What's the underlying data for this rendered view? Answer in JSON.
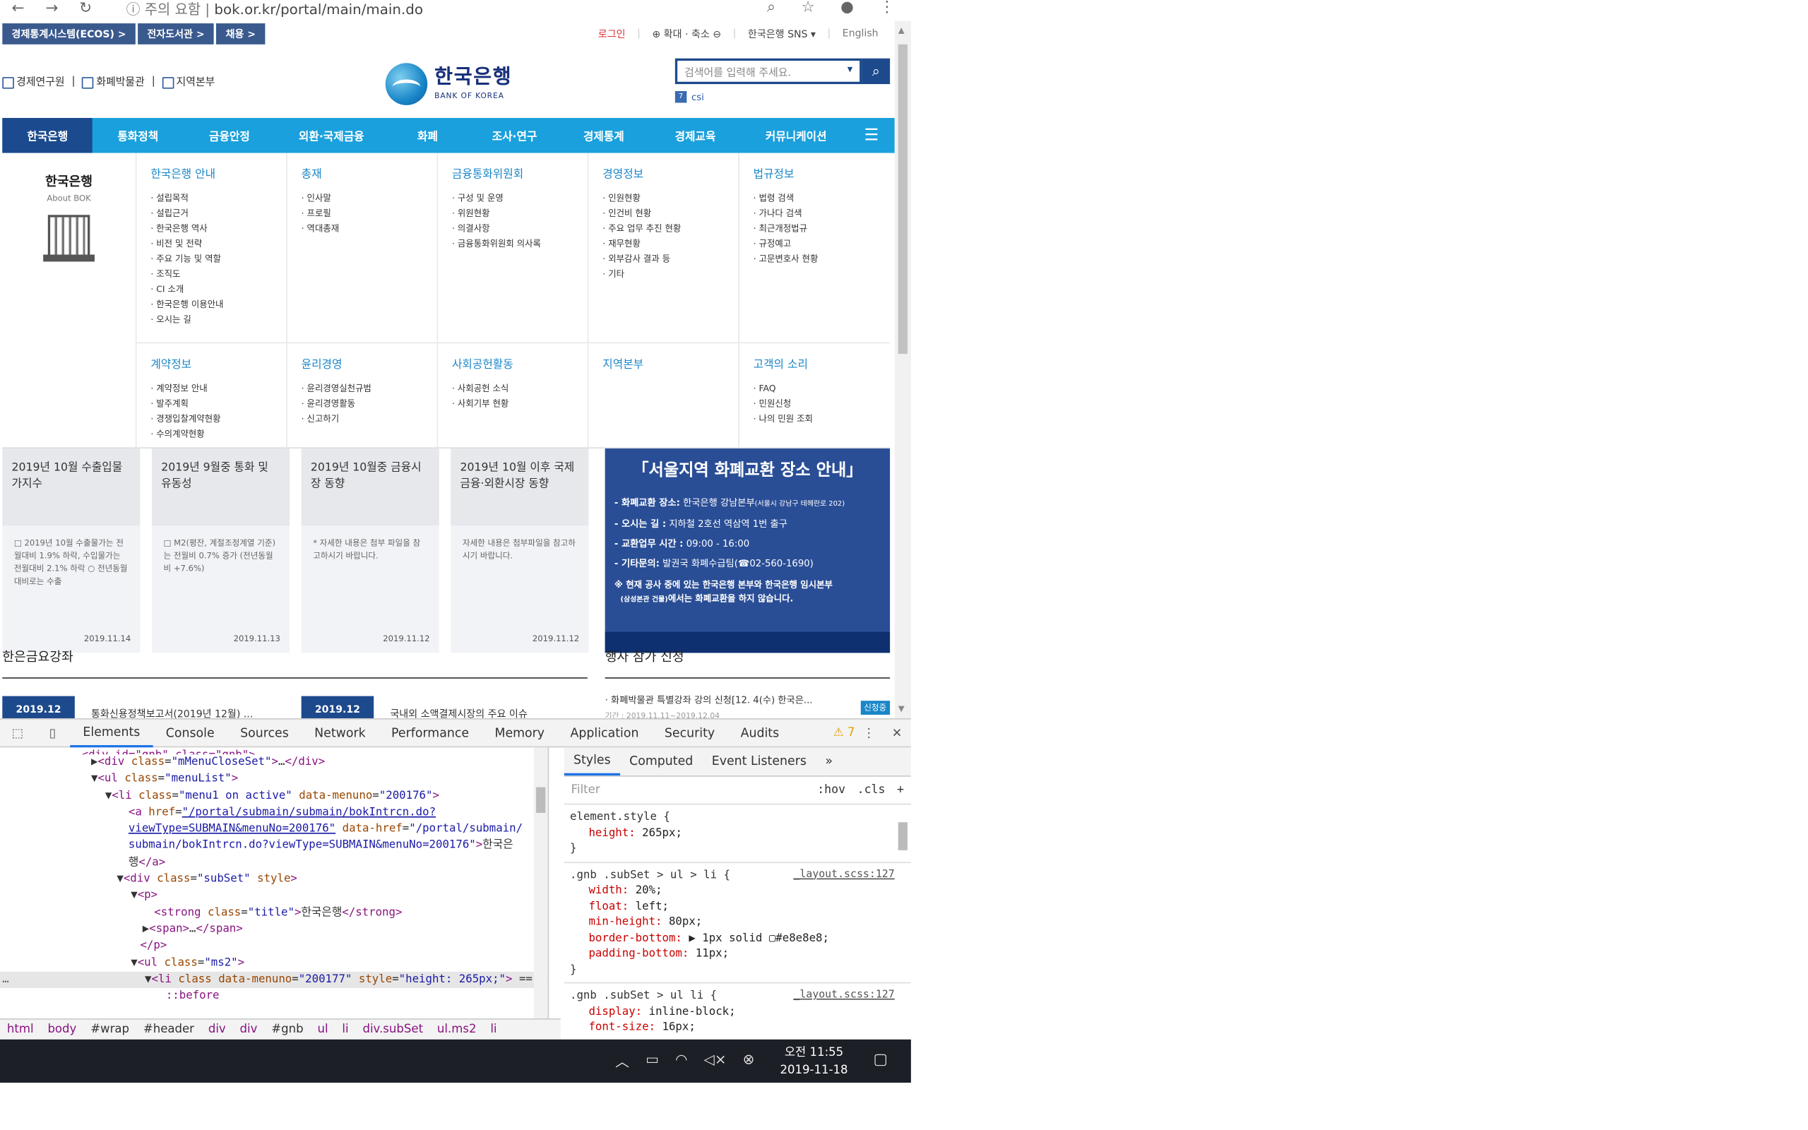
{
  "browser": {
    "url_prefix": "주의 요함",
    "url": "bok.or.kr/portal/main/main.do"
  },
  "utility": {
    "left_links": [
      "경제통계시스템(ECOS) >",
      "전자도서관 >",
      "채용 >"
    ],
    "login": "로그인",
    "zoom": "확대 · 축소",
    "sns": "한국은행 SNS",
    "english": "English"
  },
  "header": {
    "links": [
      "경제연구원",
      "화폐박물관",
      "지역본부"
    ],
    "logo_kr": "한국은행",
    "logo_en": "BANK OF KOREA",
    "search_placeholder": "검색어를 입력해 주세요.",
    "csi": "csi"
  },
  "gnb": {
    "items": [
      "한국은행",
      "통화정책",
      "금융안정",
      "외환·국제금융",
      "화폐",
      "조사·연구",
      "경제통계",
      "경제교육",
      "커뮤니케이션"
    ]
  },
  "mega": {
    "about_title": "한국은행",
    "about_sub": "About BOK",
    "row1": [
      {
        "title": "한국은행 안내",
        "items": [
          "설립목적",
          "설립근거",
          "한국은행 역사",
          "비전 및 전략",
          "주요 기능 및 역할",
          "조직도",
          "CI 소개",
          "한국은행 이용안내",
          "오시는 길"
        ]
      },
      {
        "title": "총재",
        "items": [
          "인사말",
          "프로필",
          "역대총재"
        ]
      },
      {
        "title": "금융통화위원회",
        "items": [
          "구성 및 운영",
          "위원현황",
          "의결사항",
          "금융통화위원회 의사록"
        ]
      },
      {
        "title": "경영정보",
        "items": [
          "인원현황",
          "인건비 현황",
          "주요 업무 추진 현황",
          "재무현황",
          "외부감사 결과 등",
          "기타"
        ]
      },
      {
        "title": "법규정보",
        "items": [
          "법령 검색",
          "가나다 검색",
          "최근개정법규",
          "규정예고",
          "고문변호사 현황"
        ]
      }
    ],
    "row2": [
      {
        "title": "계약정보",
        "items": [
          "계약정보 안내",
          "발주계획",
          "경쟁입찰계약현황",
          "수의계약현황"
        ]
      },
      {
        "title": "윤리경영",
        "items": [
          "윤리경영실천규범",
          "윤리경영활동",
          "신고하기"
        ]
      },
      {
        "title": "사회공헌활동",
        "items": [
          "사회공헌 소식",
          "사회기부 현황"
        ]
      },
      {
        "title": "지역본부",
        "items": []
      },
      {
        "title": "고객의 소리",
        "items": [
          "FAQ",
          "민원신청",
          "나의 민원 조회"
        ]
      }
    ]
  },
  "cards": [
    {
      "title": "2019년 10월 수출입물가지수",
      "body": "□ 2019년 10월 수출물가는 전월대비 1.9% 하락, 수입물가는 전월대비 2.1% 하락 ○ 전년동월대비로는 수출",
      "date": "2019.11.14"
    },
    {
      "title": "2019년 9월중 통화 및 유동성",
      "body": "□ M2(평잔, 계절조정계열 기준)는 전월비 0.7% 증가 (전년동월비 +7.6%)",
      "date": "2019.11.13"
    },
    {
      "title": "2019년 10월중 금융시장 동향",
      "body": "* 자세한 내용은 첨부 파일을 참고하시기 바랍니다.",
      "date": "2019.11.12"
    },
    {
      "title": "2019년 10월 이후 국제금융·외환시장 동향",
      "body": "자세한 내용은 첨부파일을 참고하시기 바랍니다.",
      "date": "2019.11.12"
    }
  ],
  "banner": {
    "title": "「서울지역 화폐교환 장소 안내」",
    "l1_k": "- 화폐교환 장소:",
    "l1_v": " 한국은행 강남본부",
    "l1_s": "(서울시 강남구 테헤란로 202)",
    "l2_k": "- 오시는 길 :",
    "l2_v": " 지하철 2호선 역삼역 1번 출구",
    "l3_k": "- 교환업무 시간 :",
    "l3_v": " 09:00 - 16:00",
    "l4_k": "- 기타문의:",
    "l4_v": " 발권국 화폐수급팀(☎02-560-1690)",
    "note1": "※ 현재 공사 중에 있는 한국은행 본부와 한국은행 임시본부",
    "note2_s": "(삼성본관 건물)",
    "note2": "에서는 화폐교환을 하지 않습니다."
  },
  "lower": {
    "left_title": "한은금요강좌",
    "right_title": "행사 참가 신청",
    "lectures": [
      {
        "date": "2019.12",
        "title": "통화신용정책보고서(2019년 12월) ..."
      },
      {
        "date": "2019.12",
        "title": "국내외 소액결제시장의 주요 이슈"
      }
    ],
    "event_title": "· 화폐박물관 특별강좌 강의 신청[12. 4(수) 한국은...",
    "event_sub": "기간 : 2019.11.11~2019.12.04",
    "event_badge": "신청중"
  },
  "devtools": {
    "tabs": [
      "Elements",
      "Console",
      "Sources",
      "Network",
      "Performance",
      "Memory",
      "Application",
      "Security",
      "Audits"
    ],
    "warn_count": "7",
    "crumbs": [
      "html",
      "body",
      "#wrap",
      "#header",
      "div",
      "div",
      "#gnb",
      "ul",
      "li",
      "div.subSet",
      "ul.ms2",
      "li"
    ],
    "styles_tabs": [
      "Styles",
      "Computed",
      "Event Listeners"
    ],
    "filter_placeholder": "Filter",
    "hov": ":hov",
    "cls": ".cls",
    "rule1_sel": "element.style {",
    "rule1_prop": "height:",
    "rule1_val": " 265px;",
    "rule2_sel": ".gnb .subSet > ul > li {",
    "rule2_src": "_layout.scss:127",
    "rule2_props": [
      [
        "width:",
        " 20%;"
      ],
      [
        "float:",
        " left;"
      ],
      [
        "min-height:",
        " 80px;"
      ],
      [
        "border-bottom:",
        " ▶ 1px solid ▢#e8e8e8;"
      ],
      [
        "padding-bottom:",
        " 11px;"
      ]
    ],
    "rule3_sel": ".gnb .subSet > ul li {",
    "rule3_src": "_layout.scss:127",
    "rule3_props": [
      [
        "display:",
        " inline-block;"
      ],
      [
        "font-size:",
        " 16px;"
      ]
    ]
  },
  "taskbar": {
    "time": "오전 11:55",
    "date": "2019-11-18"
  }
}
